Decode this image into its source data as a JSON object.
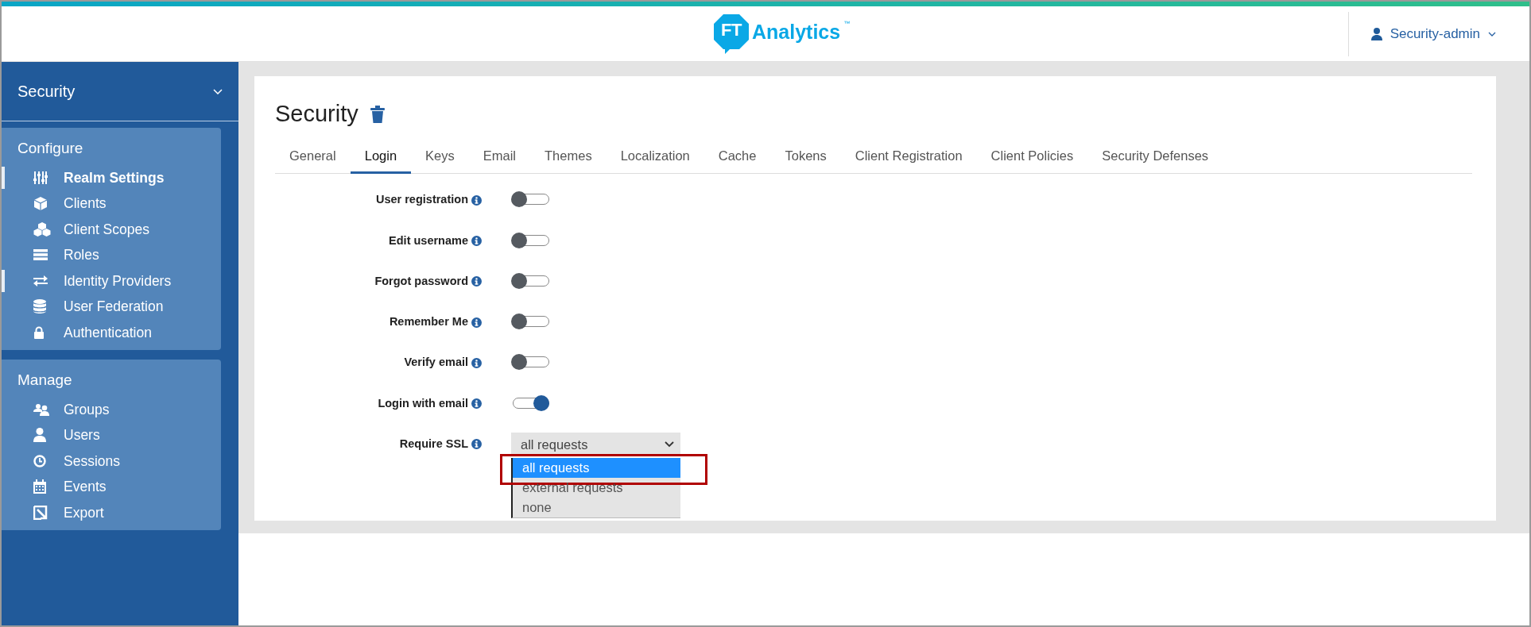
{
  "header": {
    "logo_mark": "FT",
    "logo_text": "Analytics",
    "logo_tm": "™",
    "user": "Security-admin"
  },
  "sidebar": {
    "realm": "Security",
    "sections": [
      {
        "title": "Configure",
        "items": [
          {
            "label": "Realm Settings",
            "selected": true,
            "indicator": true
          },
          {
            "label": "Clients",
            "selected": false,
            "indicator": false
          },
          {
            "label": "Client Scopes",
            "selected": false,
            "indicator": false
          },
          {
            "label": "Roles",
            "selected": false,
            "indicator": false
          },
          {
            "label": "Identity Providers",
            "selected": false,
            "indicator": true
          },
          {
            "label": "User Federation",
            "selected": false,
            "indicator": false
          },
          {
            "label": "Authentication",
            "selected": false,
            "indicator": false
          }
        ]
      },
      {
        "title": "Manage",
        "items": [
          {
            "label": "Groups",
            "selected": false,
            "indicator": false
          },
          {
            "label": "Users",
            "selected": false,
            "indicator": false
          },
          {
            "label": "Sessions",
            "selected": false,
            "indicator": false
          },
          {
            "label": "Events",
            "selected": false,
            "indicator": false
          },
          {
            "label": "Export",
            "selected": false,
            "indicator": false
          }
        ]
      }
    ]
  },
  "page": {
    "title": "Security",
    "tabs": [
      {
        "label": "General",
        "selected": false
      },
      {
        "label": "Login",
        "selected": true
      },
      {
        "label": "Keys",
        "selected": false
      },
      {
        "label": "Email",
        "selected": false
      },
      {
        "label": "Themes",
        "selected": false
      },
      {
        "label": "Localization",
        "selected": false
      },
      {
        "label": "Cache",
        "selected": false
      },
      {
        "label": "Tokens",
        "selected": false
      },
      {
        "label": "Client Registration",
        "selected": false
      },
      {
        "label": "Client Policies",
        "selected": false
      },
      {
        "label": "Security Defenses",
        "selected": false
      }
    ],
    "settings": [
      {
        "kind": "switch",
        "label": "User registration",
        "on": false
      },
      {
        "kind": "switch",
        "label": "Edit username",
        "on": false
      },
      {
        "kind": "switch",
        "label": "Forgot password",
        "on": false
      },
      {
        "kind": "switch",
        "label": "Remember Me",
        "on": false
      },
      {
        "kind": "switch",
        "label": "Verify email",
        "on": false
      },
      {
        "kind": "switch",
        "label": "Login with email",
        "on": true
      },
      {
        "kind": "select",
        "label": "Require SSL",
        "value": "all requests",
        "expanded": true,
        "options": [
          {
            "label": "all requests",
            "selected": true,
            "highlighted": true
          },
          {
            "label": "external requests",
            "selected": false,
            "highlighted": false
          },
          {
            "label": "none",
            "selected": false,
            "highlighted": false
          }
        ]
      }
    ]
  }
}
